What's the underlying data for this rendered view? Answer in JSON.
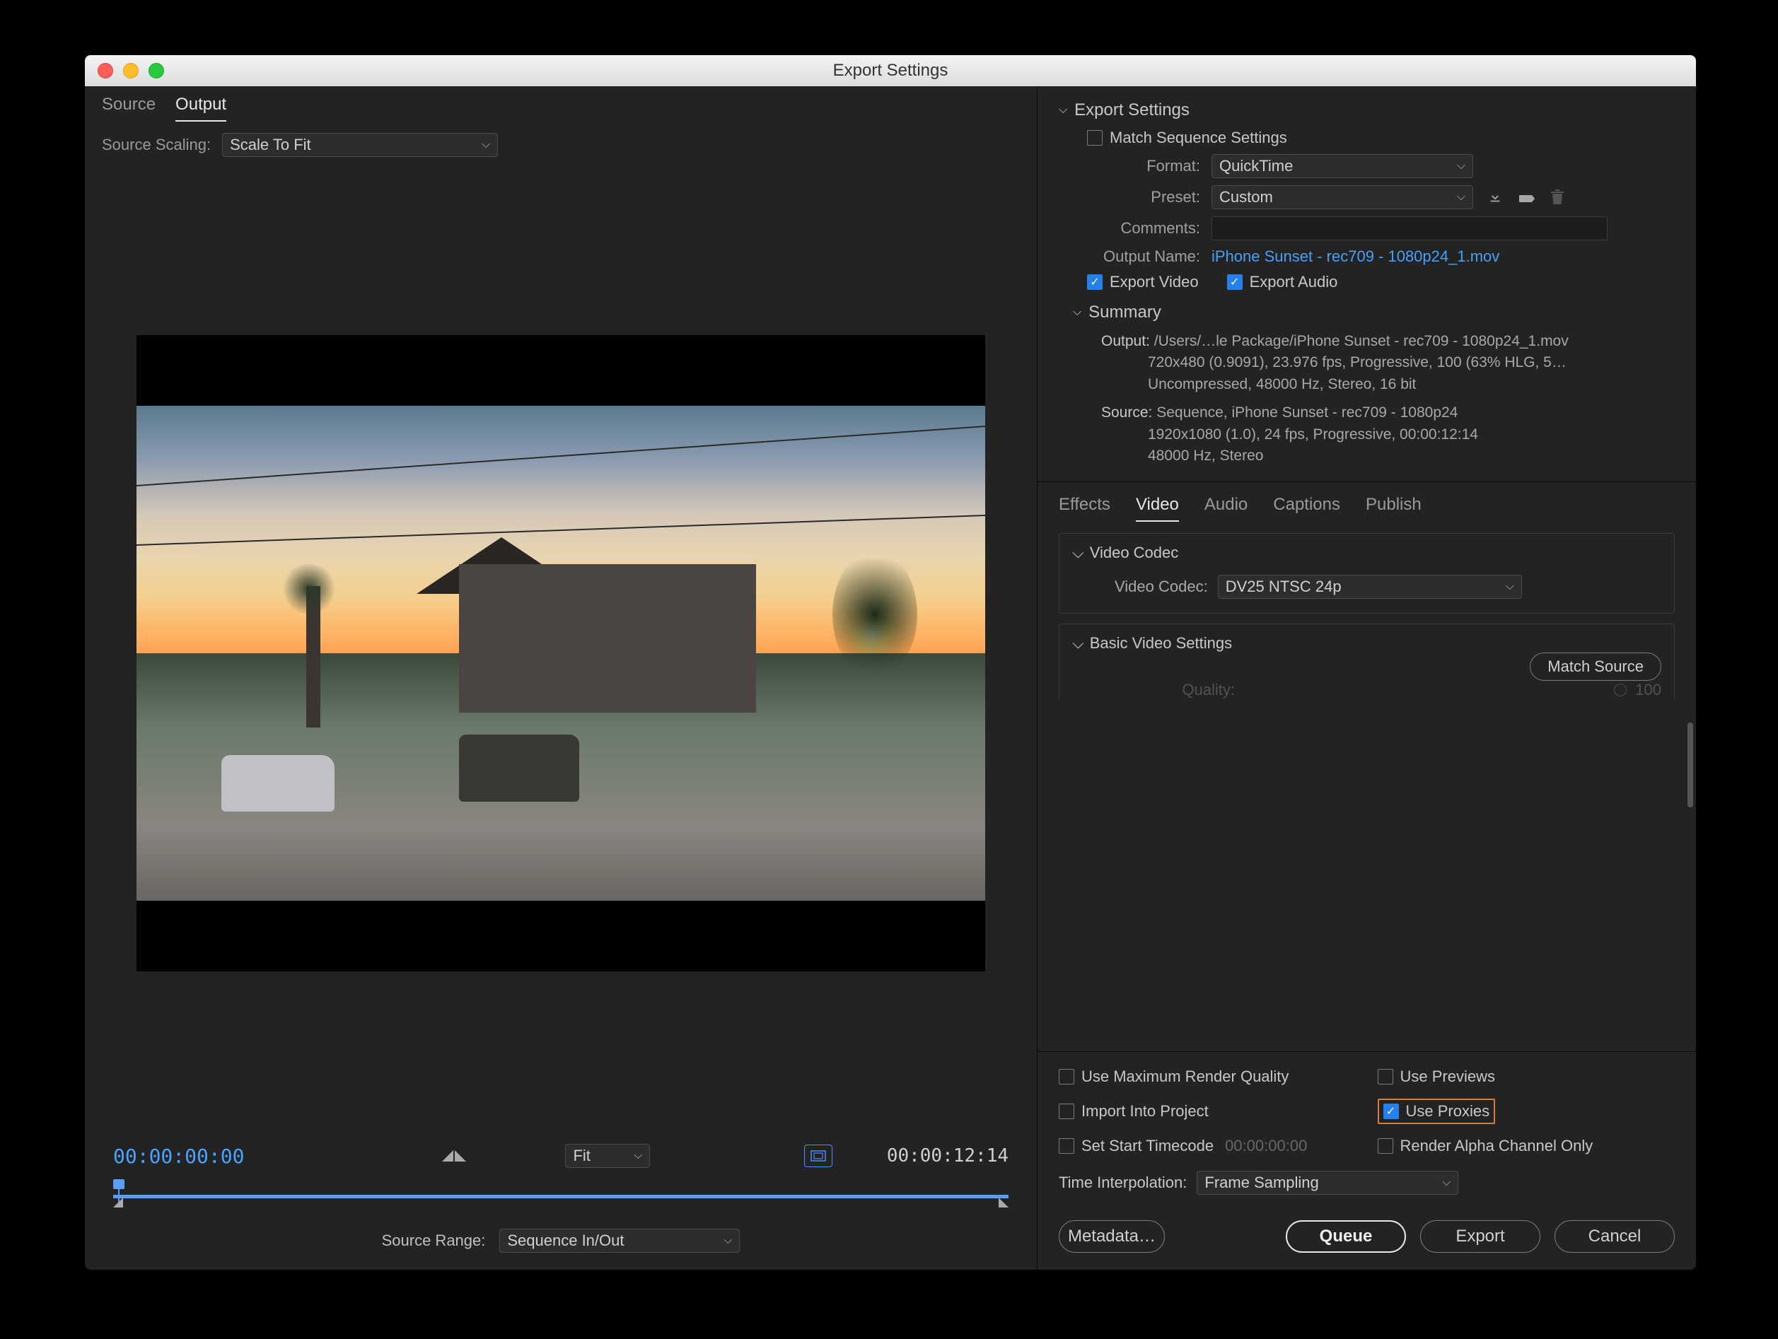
{
  "window": {
    "title": "Export Settings"
  },
  "left": {
    "tabs": {
      "source": "Source",
      "output": "Output"
    },
    "sourceScaling": {
      "label": "Source Scaling:",
      "value": "Scale To Fit"
    },
    "timecode": {
      "current": "00:00:00:00",
      "duration": "00:00:12:14",
      "fit": "Fit"
    },
    "sourceRange": {
      "label": "Source Range:",
      "value": "Sequence In/Out"
    }
  },
  "export": {
    "panelTitle": "Export Settings",
    "matchSeq": "Match Sequence Settings",
    "formatLabel": "Format:",
    "formatValue": "QuickTime",
    "presetLabel": "Preset:",
    "presetValue": "Custom",
    "commentsLabel": "Comments:",
    "outputNameLabel": "Output Name:",
    "outputName": "iPhone Sunset - rec709 - 1080p24_1.mov",
    "exportVideo": "Export Video",
    "exportAudio": "Export Audio",
    "summary": {
      "title": "Summary",
      "outputLabel": "Output:",
      "output1": "/Users/…le Package/iPhone Sunset - rec709 - 1080p24_1.mov",
      "output2": "720x480 (0.9091), 23.976 fps, Progressive, 100 (63% HLG, 5…",
      "output3": "Uncompressed, 48000 Hz, Stereo, 16 bit",
      "sourceLabel": "Source:",
      "source1": "Sequence, iPhone Sunset - rec709 - 1080p24",
      "source2": "1920x1080 (1.0), 24 fps, Progressive, 00:00:12:14",
      "source3": "48000 Hz, Stereo"
    }
  },
  "midTabs": {
    "effects": "Effects",
    "video": "Video",
    "audio": "Audio",
    "captions": "Captions",
    "publish": "Publish"
  },
  "video": {
    "codecSection": "Video Codec",
    "codecLabel": "Video Codec:",
    "codecValue": "DV25 NTSC 24p",
    "basicSection": "Basic Video Settings",
    "matchSource": "Match Source",
    "qualityLabel": "Quality:",
    "qualityValue": "100"
  },
  "bottom": {
    "maxQuality": "Use Maximum Render Quality",
    "previews": "Use Previews",
    "importProj": "Import Into Project",
    "proxies": "Use Proxies",
    "startTC": "Set Start Timecode",
    "startTCVal": "00:00:00:00",
    "alpha": "Render Alpha Channel Only",
    "interpLabel": "Time Interpolation:",
    "interpValue": "Frame Sampling",
    "buttons": {
      "metadata": "Metadata…",
      "queue": "Queue",
      "export": "Export",
      "cancel": "Cancel"
    }
  }
}
